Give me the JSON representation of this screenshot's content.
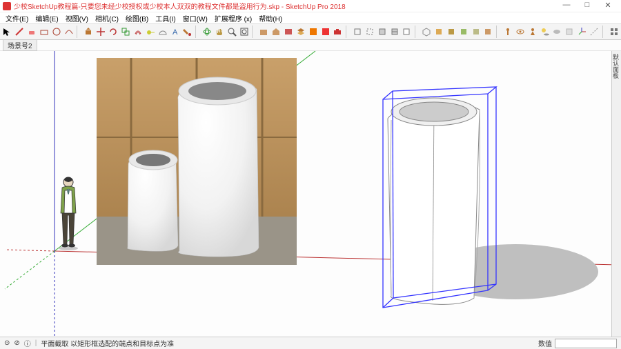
{
  "title": "少校SketchUp教程篇-只要您未经少校授权或少校本人双双的教程文件都是盗用行为.skp - SketchUp Pro 2018",
  "menu": {
    "file": "文件(E)",
    "edit": "编辑(E)",
    "view": "视图(V)",
    "camera": "相机(C)",
    "draw": "绘图(B)",
    "tools": "工具(I)",
    "window": "窗口(W)",
    "extensions": "扩展程序 (x)",
    "help": "帮助(H)"
  },
  "scene": {
    "tab": "场景号2"
  },
  "status": {
    "hint": "平面截取 以矩形框选配的端点和目标点为准",
    "label": "数值"
  },
  "sidedock": "默认面板",
  "win": {
    "min": "—",
    "max": "□",
    "close": "✕"
  },
  "statusicons": {
    "geo": "⊙",
    "person": "⊘",
    "info": "ⓘ",
    "sep": "|"
  }
}
